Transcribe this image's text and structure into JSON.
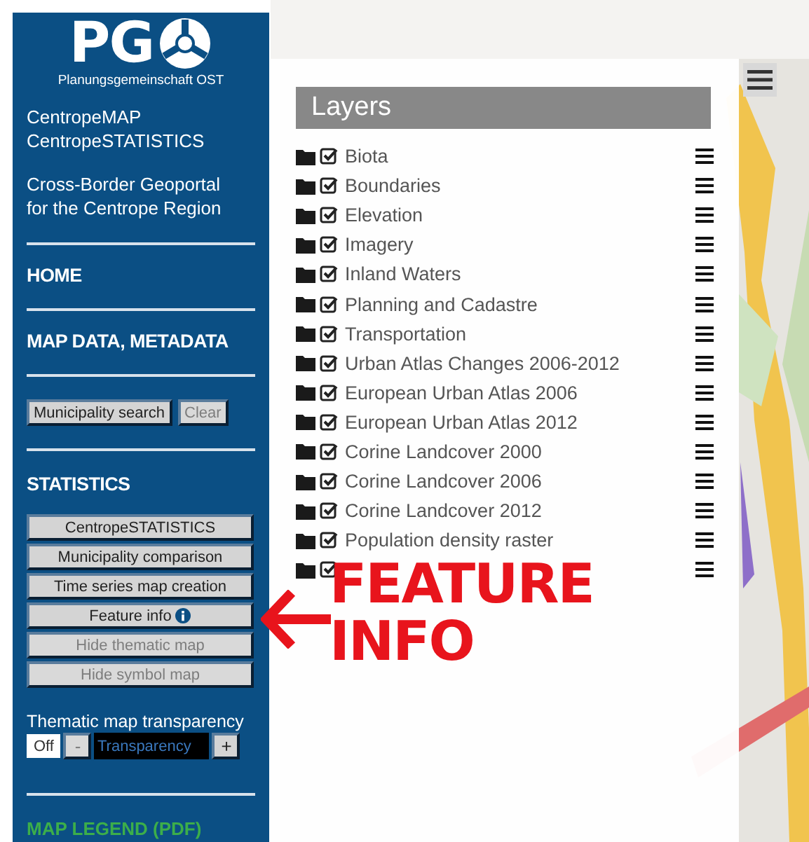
{
  "logo": {
    "letters": "PG",
    "subtitle": "Planungsgemeinschaft OST"
  },
  "sidebar": {
    "paragraphs": [
      [
        "CentropeMAP",
        "CentropeSTATISTICS"
      ],
      [
        "Cross-Border Geoportal",
        "for the Centrope Region"
      ]
    ],
    "nav": [
      {
        "label": "HOME"
      },
      {
        "label": "MAP DATA, METADATA"
      }
    ],
    "search": {
      "button": "Municipality search",
      "clear": {
        "label": "Clear",
        "disabled": true
      }
    },
    "statistics": {
      "heading": "STATISTICS",
      "buttons": [
        {
          "label": "CentropeSTATISTICS",
          "disabled": false,
          "info": false
        },
        {
          "label": "Municipality comparison",
          "disabled": false,
          "info": false
        },
        {
          "label": "Time series map creation",
          "disabled": false,
          "info": false
        },
        {
          "label": "Feature info",
          "disabled": false,
          "info": true
        },
        {
          "label": "Hide thematic map",
          "disabled": true,
          "info": false
        },
        {
          "label": "Hide symbol map",
          "disabled": true,
          "info": false
        }
      ]
    },
    "transparency": {
      "label": "Thematic map transparency",
      "off": "Off",
      "minus": {
        "label": "-",
        "disabled": true
      },
      "placeholder": "Transparency",
      "plus": "+"
    },
    "legend_link": "MAP LEGEND (PDF)"
  },
  "layers": {
    "title": "Layers",
    "items": [
      {
        "name": "Biota",
        "checked": true
      },
      {
        "name": "Boundaries",
        "checked": true
      },
      {
        "name": "Elevation",
        "checked": true
      },
      {
        "name": "Imagery",
        "checked": true
      },
      {
        "name": "Inland Waters",
        "checked": true
      },
      {
        "name": "Planning and Cadastre",
        "checked": true
      },
      {
        "name": "Transportation",
        "checked": true
      },
      {
        "name": "Urban Atlas Changes 2006-2012",
        "checked": true
      },
      {
        "name": "European Urban Atlas 2006",
        "checked": true
      },
      {
        "name": "European Urban Atlas 2012",
        "checked": true
      },
      {
        "name": "Corine Landcover 2000",
        "checked": true
      },
      {
        "name": "Corine Landcover 2006",
        "checked": true
      },
      {
        "name": "Corine Landcover 2012",
        "checked": true
      },
      {
        "name": "Population density raster",
        "checked": true
      },
      {
        "checked": true
      }
    ]
  },
  "annotation": {
    "lines": [
      "FEATURE",
      "INFO"
    ]
  }
}
